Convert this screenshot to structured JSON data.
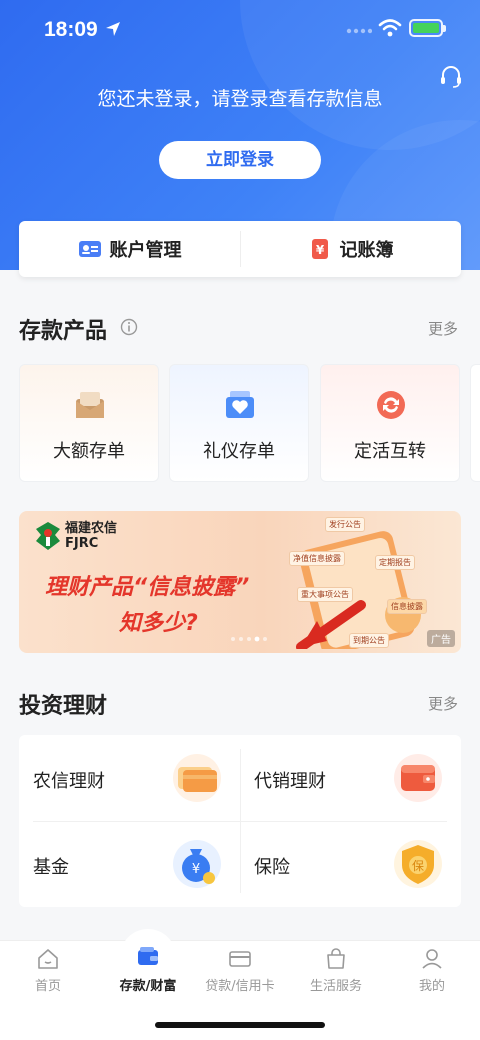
{
  "status_bar": {
    "time": "18:09"
  },
  "header": {
    "prompt": "您还未登录，请登录查看存款信息",
    "login_button": "立即登录"
  },
  "quick_actions": [
    {
      "label": "账户管理",
      "icon": "account-card-icon"
    },
    {
      "label": "记账簿",
      "icon": "ledger-icon"
    }
  ],
  "deposit": {
    "title": "存款产品",
    "more": "更多",
    "items": [
      {
        "label": "大额存单",
        "icon": "envelope-icon"
      },
      {
        "label": "礼仪存单",
        "icon": "gift-heart-icon"
      },
      {
        "label": "定活互转",
        "icon": "exchange-icon"
      }
    ]
  },
  "banner": {
    "brand_cn": "福建农信",
    "brand_en": "FJRC",
    "headline1": "理财产品“信息披露”",
    "headline2": "知多少?",
    "tags": [
      "发行公告",
      "净值信息披露",
      "定期报告",
      "重大事项公告",
      "信息披露",
      "到期公告"
    ],
    "ad_label": "广告"
  },
  "invest": {
    "title": "投资理财",
    "more": "更多",
    "items": [
      {
        "label": "农信理财",
        "icon": "card-icon"
      },
      {
        "label": "代销理财",
        "icon": "wallet-icon"
      },
      {
        "label": "基金",
        "icon": "money-bag-icon"
      },
      {
        "label": "保险",
        "icon": "shield-icon"
      }
    ]
  },
  "tabbar": {
    "tabs": [
      {
        "label": "首页"
      },
      {
        "label": "存款/财富"
      },
      {
        "label": "贷款/信用卡"
      },
      {
        "label": "生活服务"
      },
      {
        "label": "我的"
      }
    ],
    "active_index": 1
  },
  "colors": {
    "primary": "#2f6bf0",
    "accent_red": "#e4362b",
    "orange": "#f59b45"
  }
}
